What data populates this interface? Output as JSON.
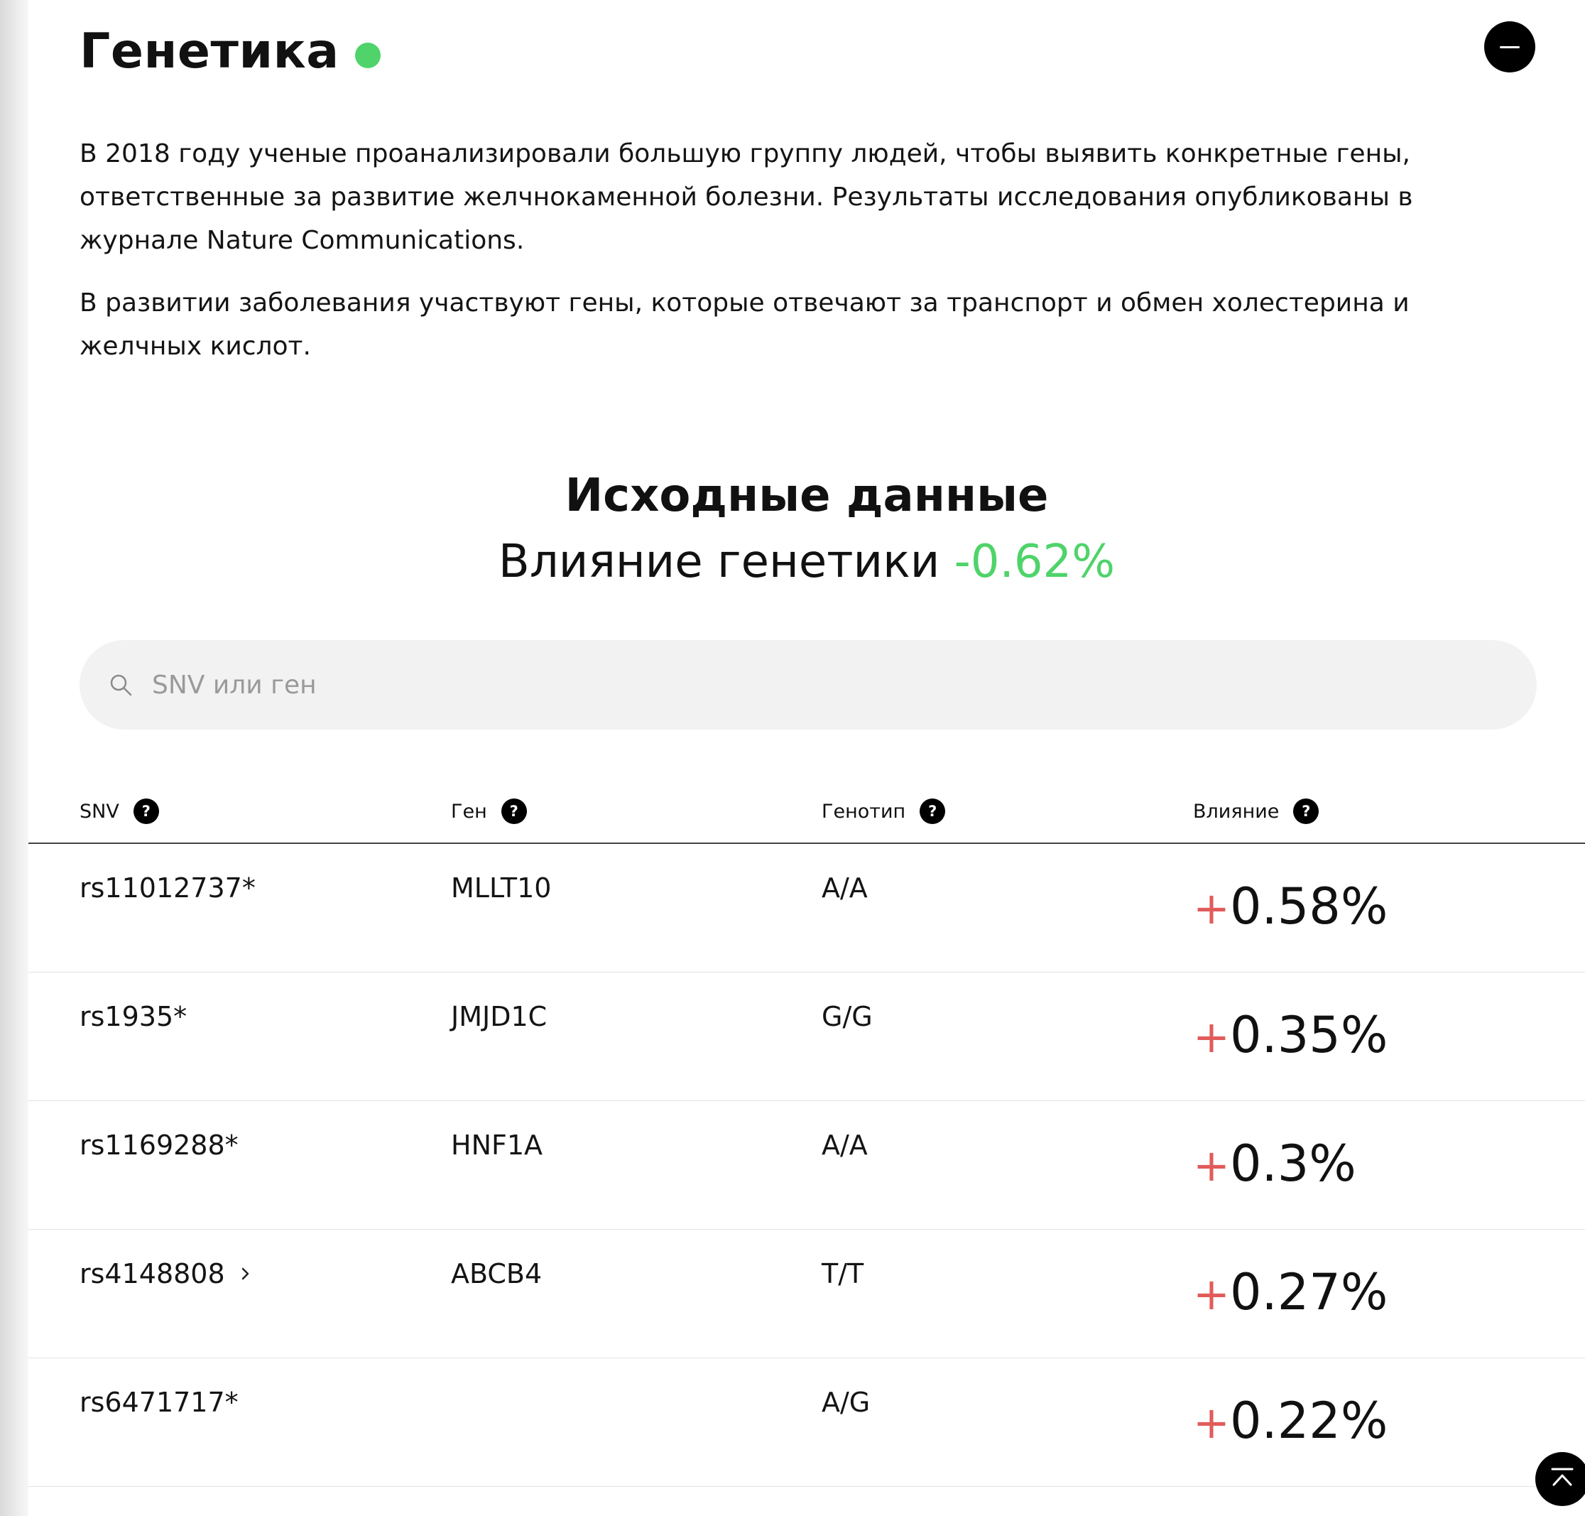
{
  "section": {
    "title": "Генетика",
    "status_color": "#4fd36a",
    "collapse_icon": "minus-icon"
  },
  "description": {
    "paragraph1": "В 2018 году ученые проанализировали большую группу людей, чтобы выявить конкретные гены, ответственные за развитие желчнокаменной болезни. Результаты исследования опубликованы в журнале Nature Communications.",
    "paragraph2": "В развитии заболевания участвуют гены, которые отвечают за транспорт и обмен холестерина и желчных кислот."
  },
  "summary": {
    "title": "Исходные данные",
    "label": "Влияние генетики",
    "value": "-0.62%",
    "value_color": "#4fd36a"
  },
  "search": {
    "placeholder": "SNV или ген",
    "value": ""
  },
  "table": {
    "headers": [
      "SNV",
      "Ген",
      "Генотип",
      "Влияние"
    ],
    "help_glyph": "?",
    "rows": [
      {
        "snv": "rs11012737*",
        "gene": "MLLT10",
        "genotype": "A/A",
        "sign": "+",
        "impact": "0.58%",
        "has_chevron": false
      },
      {
        "snv": "rs1935*",
        "gene": "JMJD1C",
        "genotype": "G/G",
        "sign": "+",
        "impact": "0.35%",
        "has_chevron": false
      },
      {
        "snv": "rs1169288*",
        "gene": "HNF1A",
        "genotype": "A/A",
        "sign": "+",
        "impact": "0.3%",
        "has_chevron": false
      },
      {
        "snv": "rs4148808",
        "gene": "ABCB4",
        "genotype": "T/T",
        "sign": "+",
        "impact": "0.27%",
        "has_chevron": true
      },
      {
        "snv": "rs6471717*",
        "gene": "",
        "genotype": "A/G",
        "sign": "+",
        "impact": "0.22%",
        "has_chevron": false
      }
    ],
    "positive_sign_color": "#e25b5b"
  },
  "scroll_top": {
    "icon": "arrow-up-to-top-icon"
  }
}
